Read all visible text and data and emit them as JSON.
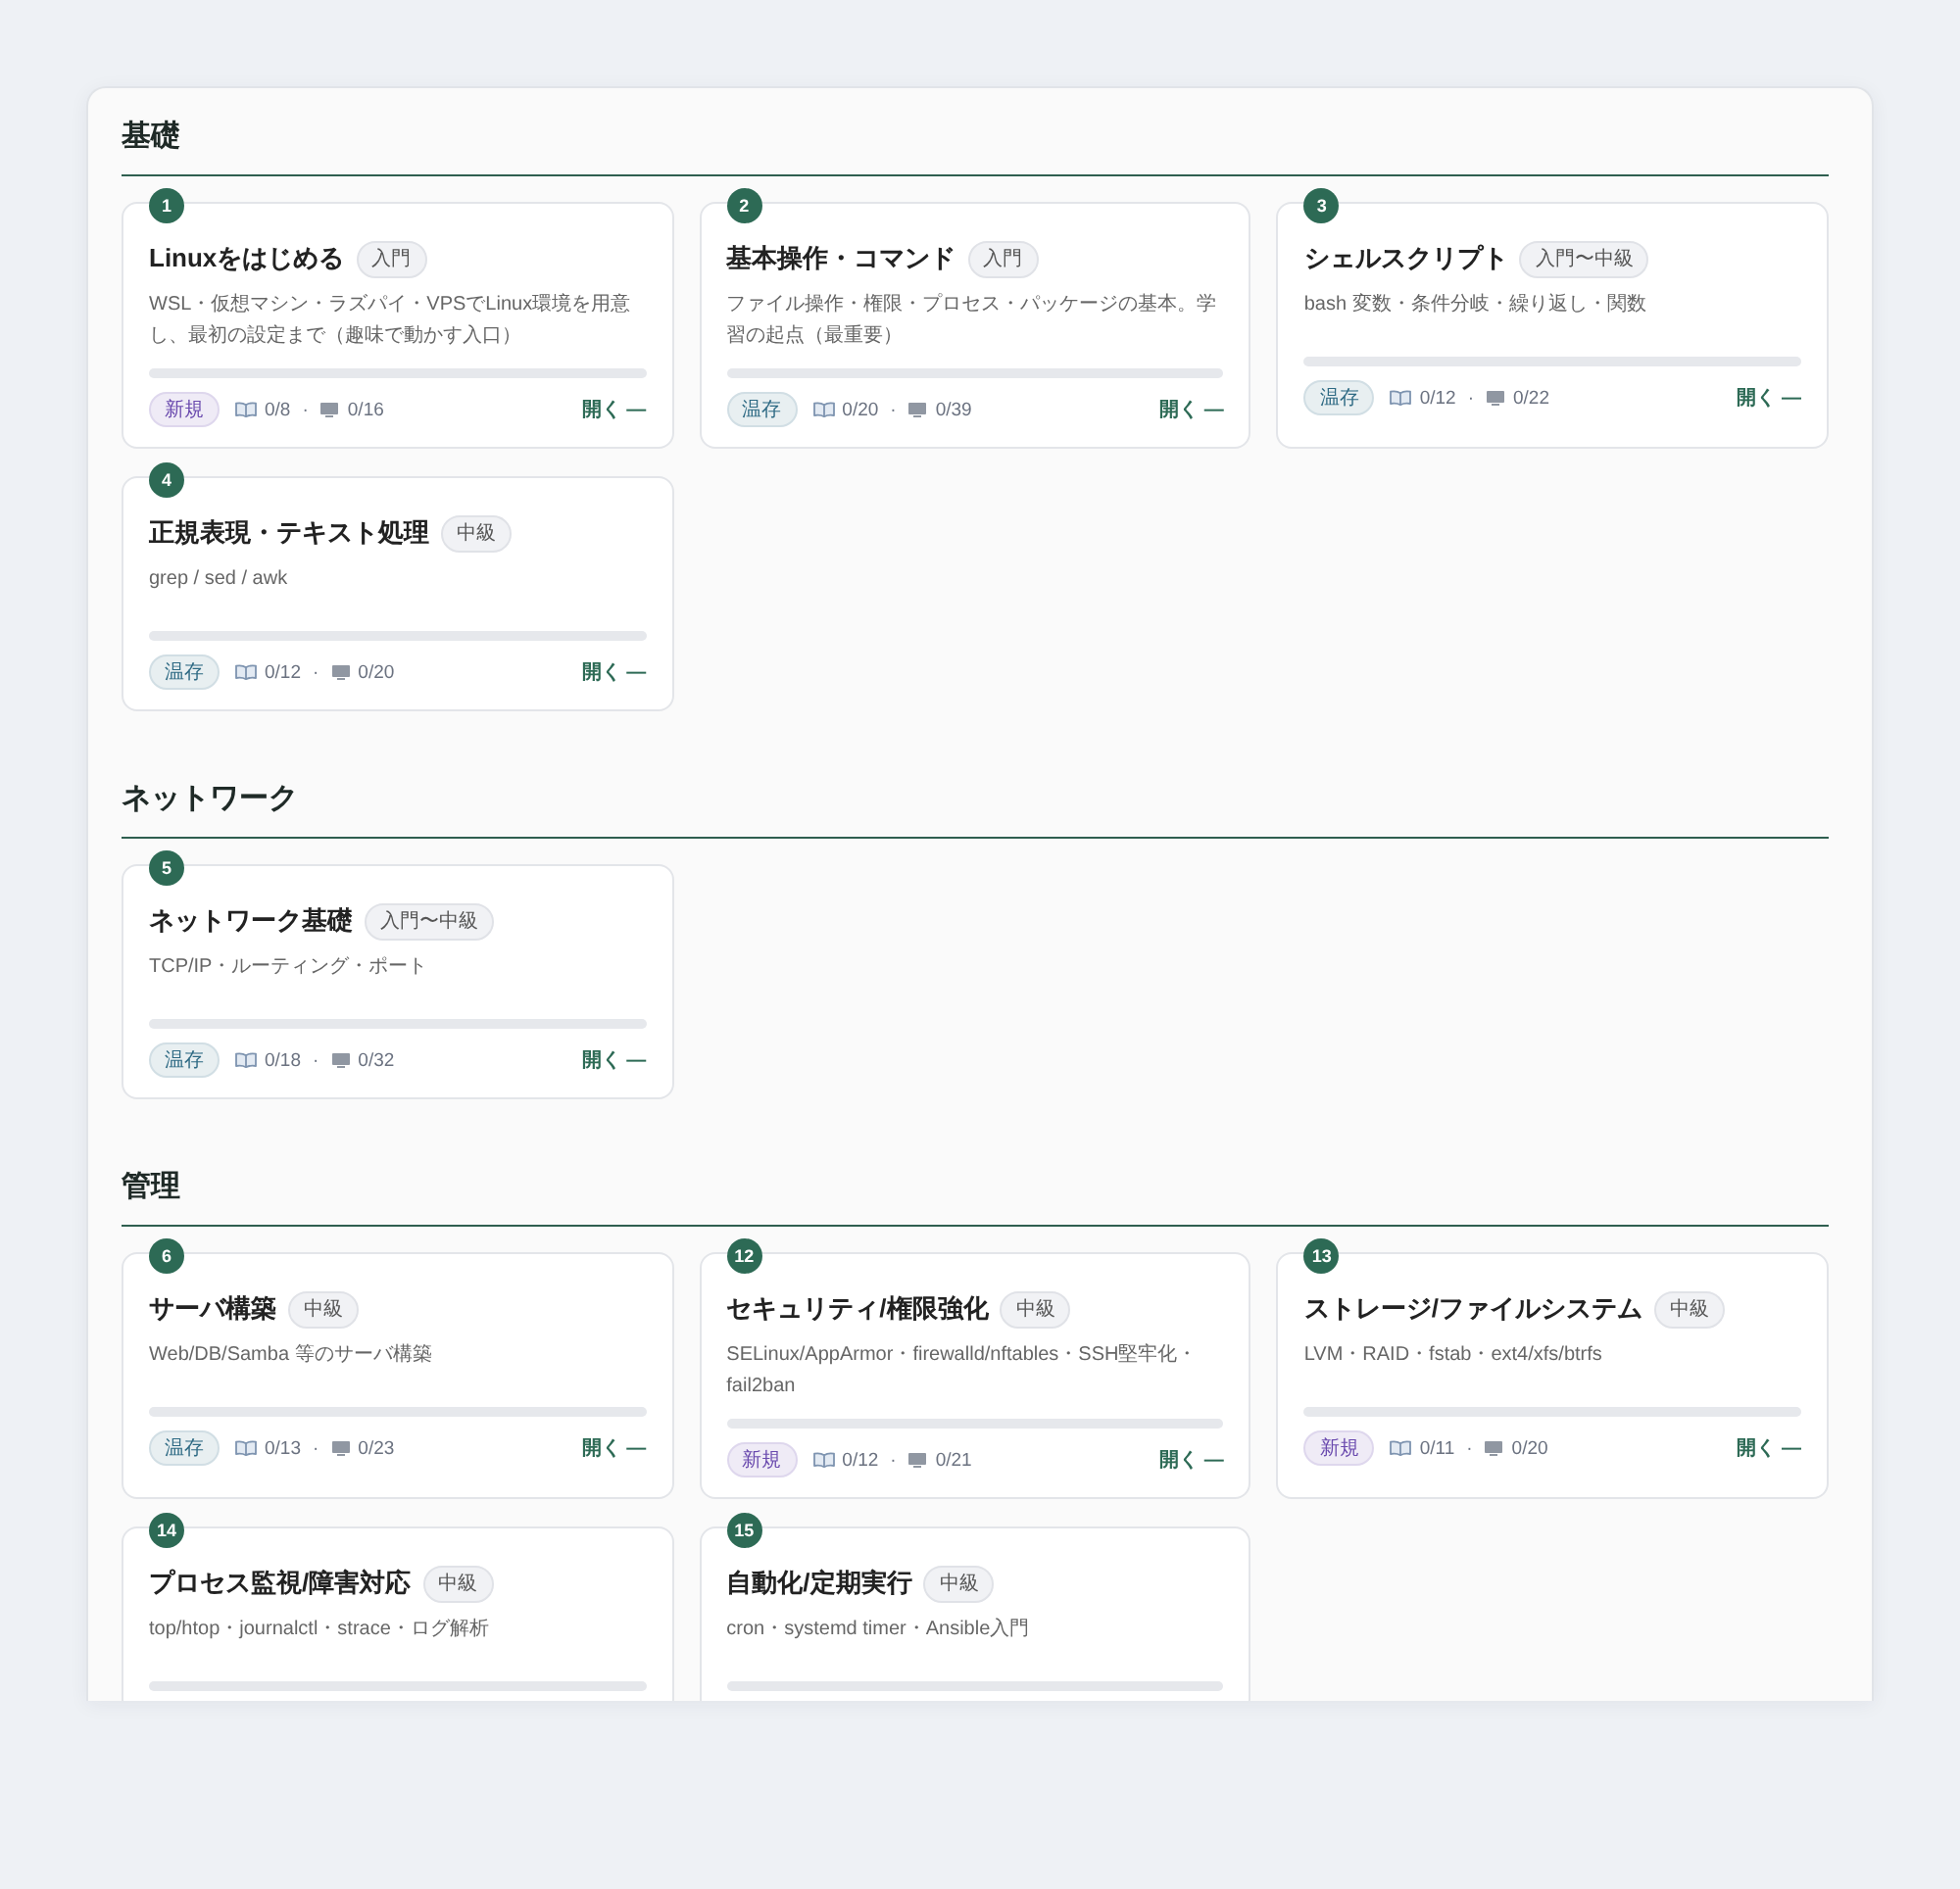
{
  "sections": [
    {
      "title": "基礎",
      "cards": [
        {
          "number": "1",
          "title": "Linuxをはじめる",
          "difficulty": "入門",
          "description": "WSL・仮想マシン・ラズパイ・VPSでLinux環境を用意し、最初の設定まで（趣味で動かす入口）",
          "status": {
            "label": "新規",
            "color": "#6a4aae"
          },
          "book_count": "0/8",
          "count_separator": "·",
          "screen_count": "0/16",
          "open_label": "開く —"
        },
        {
          "number": "2",
          "title": "基本操作・コマンド",
          "difficulty": "入門",
          "description": "ファイル操作・権限・プロセス・パッケージの基本。学習の起点（最重要）",
          "status": {
            "label": "温存",
            "color": "#2e6a84"
          },
          "book_count": "0/20",
          "count_separator": "·",
          "screen_count": "0/39",
          "open_label": "開く —"
        },
        {
          "number": "3",
          "title": "シェルスクリプト",
          "difficulty": "入門〜中級",
          "description": "bash 変数・条件分岐・繰り返し・関数",
          "status": {
            "label": "温存",
            "color": "#2e6a84"
          },
          "book_count": "0/12",
          "count_separator": "·",
          "screen_count": "0/22",
          "open_label": "開く —"
        },
        {
          "number": "4",
          "title": "正規表現・テキスト処理",
          "difficulty": "中級",
          "description": "grep / sed / awk",
          "status": {
            "label": "温存",
            "color": "#2e6a84"
          },
          "book_count": "0/12",
          "count_separator": "·",
          "screen_count": "0/20",
          "open_label": "開く —"
        }
      ]
    },
    {
      "title": "ネットワーク",
      "cards": [
        {
          "number": "5",
          "title": "ネットワーク基礎",
          "difficulty": "入門〜中級",
          "description": "TCP/IP・ルーティング・ポート",
          "status": {
            "label": "温存",
            "color": "#2e6a84"
          },
          "book_count": "0/18",
          "count_separator": "·",
          "screen_count": "0/32",
          "open_label": "開く —"
        }
      ]
    },
    {
      "title": "管理",
      "cards": [
        {
          "number": "6",
          "title": "サーバ構築",
          "difficulty": "中級",
          "description": "Web/DB/Samba 等のサーバ構築",
          "status": {
            "label": "温存",
            "color": "#2e6a84"
          },
          "book_count": "0/13",
          "count_separator": "·",
          "screen_count": "0/23",
          "open_label": "開く —"
        },
        {
          "number": "12",
          "title": "セキュリティ/権限強化",
          "difficulty": "中級",
          "description": "SELinux/AppArmor・firewalld/nftables・SSH堅牢化・fail2ban",
          "status": {
            "label": "新規",
            "color": "#6a4aae"
          },
          "book_count": "0/12",
          "count_separator": "·",
          "screen_count": "0/21",
          "open_label": "開く —"
        },
        {
          "number": "13",
          "title": "ストレージ/ファイルシステム",
          "difficulty": "中級",
          "description": "LVM・RAID・fstab・ext4/xfs/btrfs",
          "status": {
            "label": "新規",
            "color": "#6a4aae"
          },
          "book_count": "0/11",
          "count_separator": "·",
          "screen_count": "0/20",
          "open_label": "開く —"
        },
        {
          "number": "14",
          "title": "プロセス監視/障害対応",
          "difficulty": "中級",
          "description": "top/htop・journalctl・strace・ログ解析"
        },
        {
          "number": "15",
          "title": "自動化/定期実行",
          "difficulty": "中級",
          "description": "cron・systemd timer・Ansible入門"
        }
      ]
    }
  ]
}
